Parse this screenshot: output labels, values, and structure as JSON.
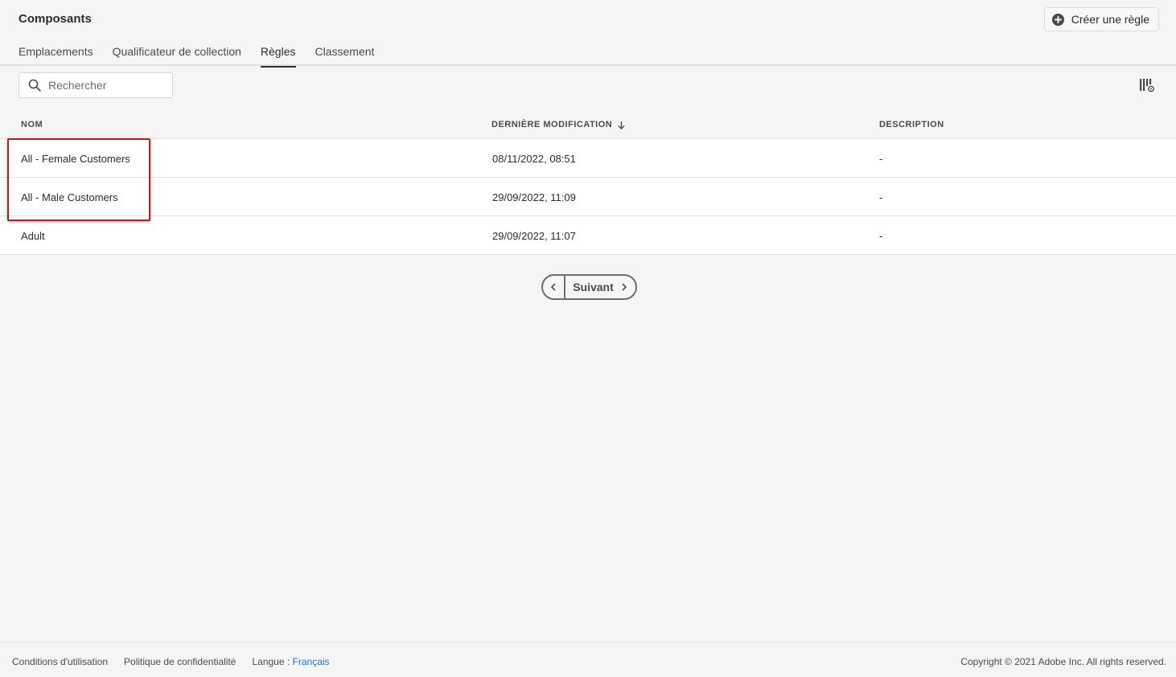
{
  "header": {
    "title": "Composants",
    "create_button_label": "Créer une règle"
  },
  "tabs": [
    {
      "label": "Emplacements",
      "active": false
    },
    {
      "label": "Qualificateur de collection",
      "active": false
    },
    {
      "label": "Règles",
      "active": true
    },
    {
      "label": "Classement",
      "active": false
    }
  ],
  "search": {
    "placeholder": "Rechercher",
    "value": ""
  },
  "table": {
    "columns": {
      "name": "NOM",
      "modified": "DERNIÈRE MODIFICATION",
      "description": "DESCRIPTION"
    },
    "sort": {
      "column": "modified",
      "direction": "desc"
    },
    "rows": [
      {
        "name": "All - Female Customers",
        "modified": "08/11/2022, 08:51",
        "description": "-"
      },
      {
        "name": "All - Male Customers",
        "modified": "29/09/2022, 11:09",
        "description": "-"
      },
      {
        "name": "Adult",
        "modified": "29/09/2022, 11:07",
        "description": "-"
      }
    ]
  },
  "pagination": {
    "next_label": "Suivant"
  },
  "footer": {
    "terms": "Conditions d'utilisation",
    "privacy": "Politique de confidentialité",
    "language_label": "Langue :",
    "language_value": "Français",
    "copyright": "Copyright ©  2021 Adobe Inc.  All rights reserved."
  },
  "colors": {
    "highlight": "#b3201f",
    "link": "#1473e6",
    "background": "#f5f5f5"
  }
}
